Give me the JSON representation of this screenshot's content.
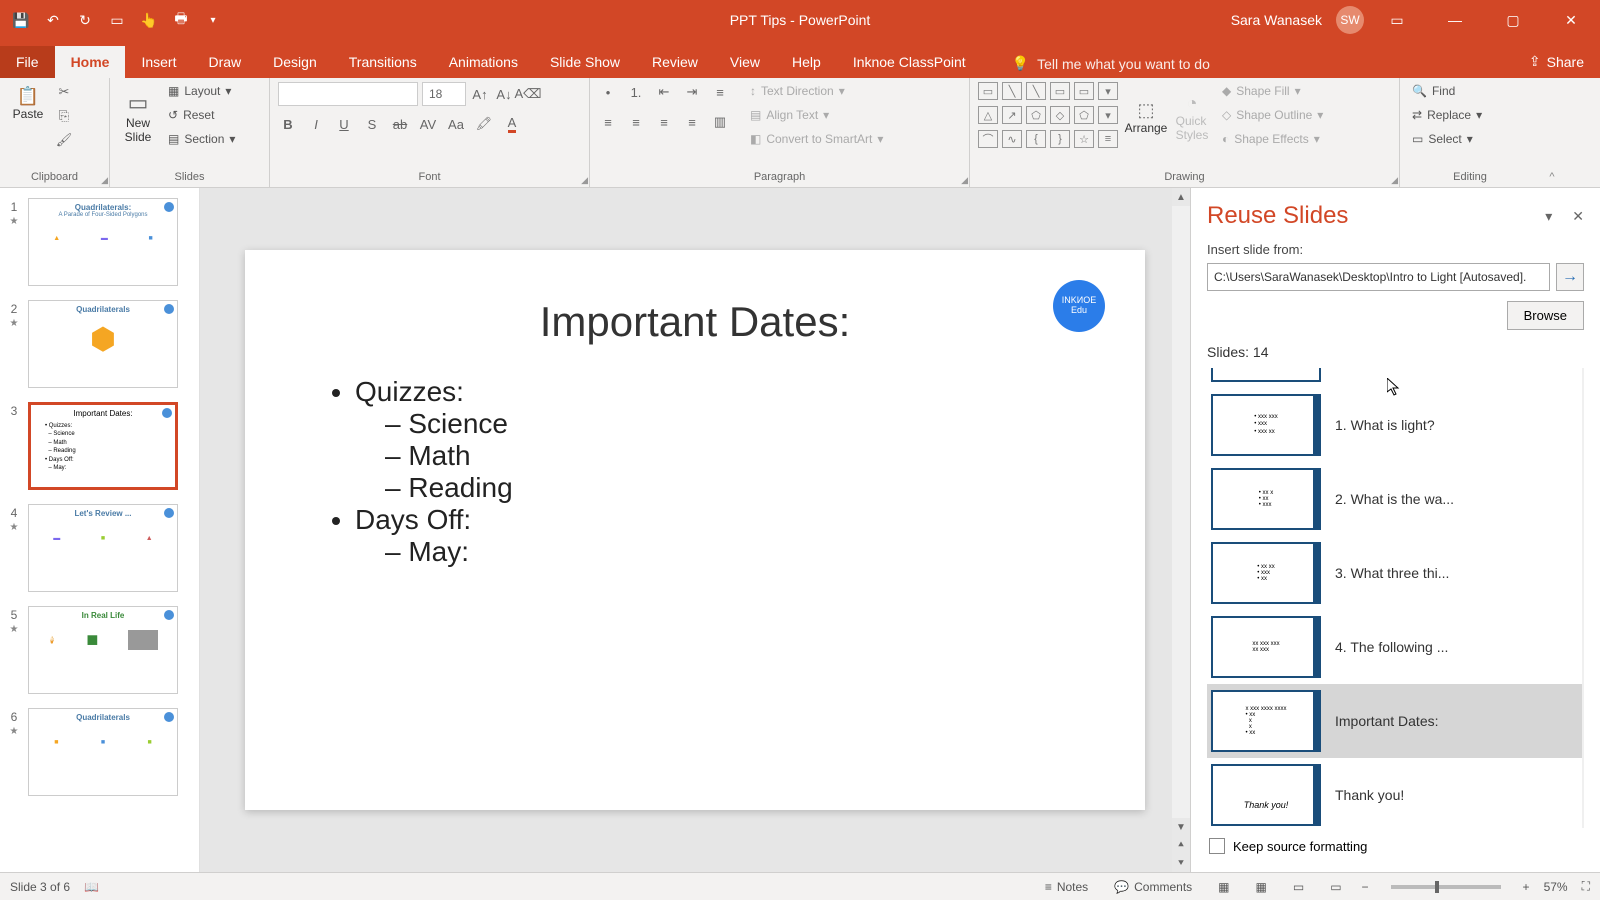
{
  "title": "PPT Tips - PowerPoint",
  "user": {
    "name": "Sara Wanasek",
    "initials": "SW"
  },
  "menu": {
    "file": "File",
    "tabs": [
      "Home",
      "Insert",
      "Draw",
      "Design",
      "Transitions",
      "Animations",
      "Slide Show",
      "Review",
      "View",
      "Help",
      "Inknoe ClassPoint"
    ],
    "active": "Home",
    "tellme": "Tell me what you want to do",
    "share": "Share"
  },
  "ribbon": {
    "clipboard": {
      "label": "Clipboard",
      "paste": "Paste"
    },
    "slides": {
      "label": "Slides",
      "newslide": "New\nSlide",
      "layout": "Layout",
      "reset": "Reset",
      "section": "Section"
    },
    "font": {
      "label": "Font",
      "size": "18"
    },
    "paragraph": {
      "label": "Paragraph",
      "textdir": "Text Direction",
      "aligntext": "Align Text",
      "smartart": "Convert to SmartArt"
    },
    "drawing": {
      "label": "Drawing",
      "arrange": "Arrange",
      "quickstyles": "Quick\nStyles",
      "fill": "Shape Fill",
      "outline": "Shape Outline",
      "effects": "Shape Effects"
    },
    "editing": {
      "label": "Editing",
      "find": "Find",
      "replace": "Replace",
      "select": "Select"
    }
  },
  "thumbs": [
    {
      "num": "1",
      "title": "Quadrilaterals:",
      "sub": "A Parade of Four-Sided Polygons"
    },
    {
      "num": "2",
      "title": "Quadrilaterals"
    },
    {
      "num": "3",
      "title": "Important Dates:"
    },
    {
      "num": "4",
      "title": "Let's Review ..."
    },
    {
      "num": "5",
      "title": "In Real Life"
    },
    {
      "num": "6",
      "title": "Quadrilaterals"
    }
  ],
  "slide": {
    "title": "Important Dates:",
    "b1": "Quizzes:",
    "s1a": "Science",
    "s1b": "Math",
    "s1c": "Reading",
    "b2": "Days Off:",
    "s2a": "May:",
    "badge": "INKИOE\nEdu"
  },
  "reuse": {
    "title": "Reuse Slides",
    "insertfrom": "Insert slide from:",
    "path": "C:\\Users\\SaraWanasek\\Desktop\\Intro to Light [Autosaved].",
    "browse": "Browse",
    "count": "Slides: 14",
    "items": [
      {
        "label": "1. What is light?"
      },
      {
        "label": "2. What is the wa..."
      },
      {
        "label": "3. What three thi..."
      },
      {
        "label": "4. The following ..."
      },
      {
        "label": "Important Dates:"
      },
      {
        "label": "Thank you!"
      }
    ],
    "keep": "Keep source formatting"
  },
  "status": {
    "slide": "Slide 3 of 6",
    "notes": "Notes",
    "comments": "Comments",
    "zoom": "57%"
  }
}
